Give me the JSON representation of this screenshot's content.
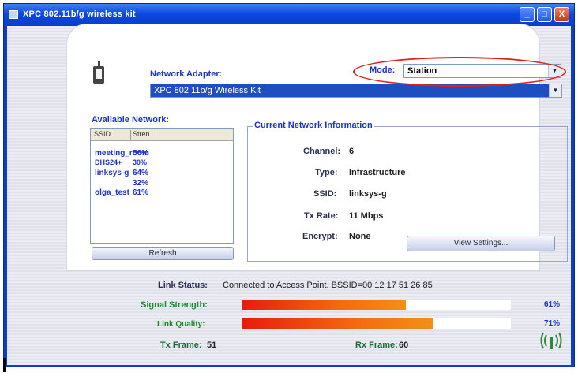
{
  "window": {
    "title": "XPC 802.11b/g wireless kit"
  },
  "title_buttons": {
    "minimize": "_",
    "maximize": "□",
    "close": "X"
  },
  "adapter": {
    "label": "Network Adapter:",
    "value": "XPC 802.11b/g Wireless Kit"
  },
  "mode": {
    "label": "Mode:",
    "value": "Station"
  },
  "networks": {
    "label": "Available Network:",
    "headers": [
      "SSID",
      "Stren..."
    ],
    "rows": [
      {
        "ssid": "meeting_room",
        "strength": "56%"
      },
      {
        "ssid": "DHS24+",
        "strength": "30%"
      },
      {
        "ssid": "linksys-g",
        "strength": "64%"
      },
      {
        "ssid": "",
        "strength": "32%"
      },
      {
        "ssid": "olga_test",
        "strength": "61%"
      }
    ],
    "refresh_label": "Refresh"
  },
  "current": {
    "title": "Current Network Information",
    "channel_label": "Channel:",
    "channel": "6",
    "type_label": "Type:",
    "type": "Infrastructure",
    "ssid_label": "SSID:",
    "ssid": "linksys-g",
    "txrate_label": "Tx Rate:",
    "txrate": "11 Mbps",
    "encrypt_label": "Encrypt:",
    "encrypt": "None",
    "view_settings_label": "View Settings..."
  },
  "status": {
    "link_label": "Link Status:",
    "link_value": "Connected to Access Point. BSSID=00 12 17 51 26 85",
    "signal_label": "Signal Strength:",
    "signal_value": "61%",
    "signal_fraction": 0.61,
    "quality_label": "Link Quality:",
    "quality_value": "71%",
    "quality_fraction": 0.71,
    "tx_label": "Tx Frame:",
    "tx_value": "51",
    "rx_label": "Rx Frame:",
    "rx_value": "60"
  },
  "colors": {
    "accent": "#1a34c8",
    "label_green": "#1e8a2c",
    "bar": "#f46a10",
    "highlight": "#e02020"
  },
  "icons": [
    "adapter-icon",
    "wireless-signal-icon",
    "dropdown-arrow-icon"
  ]
}
